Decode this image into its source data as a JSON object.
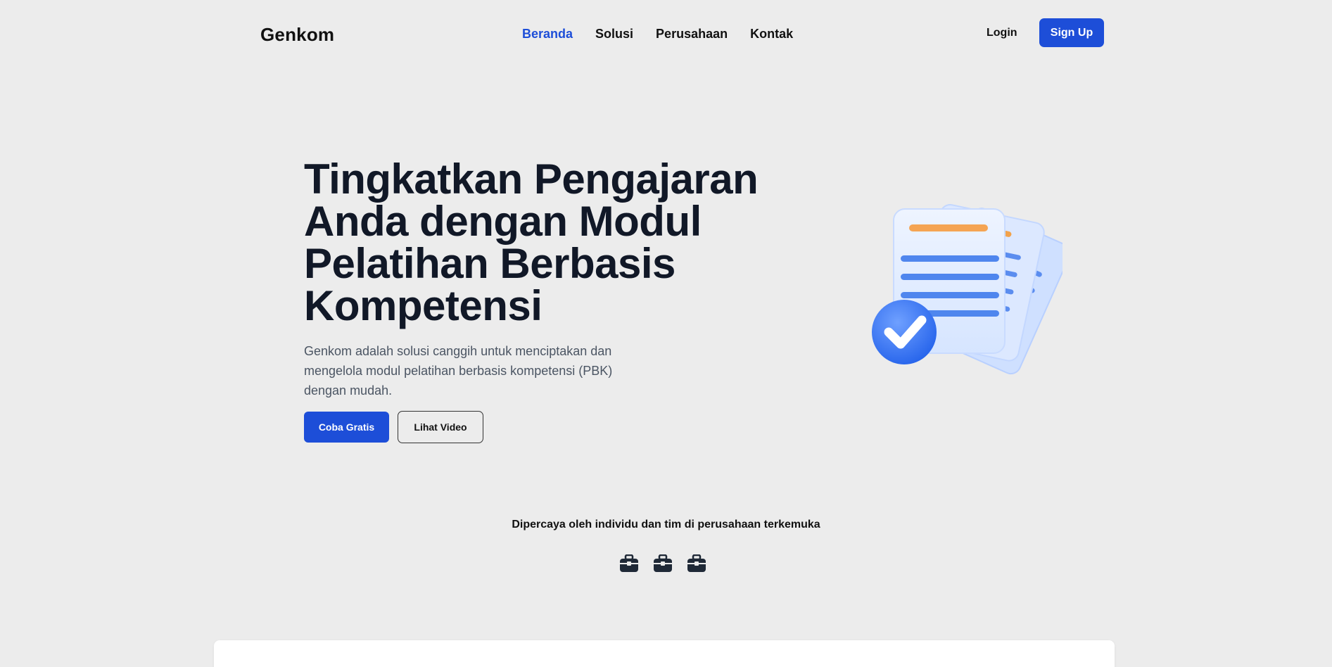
{
  "brand": "Genkom",
  "nav": {
    "items": [
      {
        "label": "Beranda",
        "active": true
      },
      {
        "label": "Solusi",
        "active": false
      },
      {
        "label": "Perusahaan",
        "active": false
      },
      {
        "label": "Kontak",
        "active": false
      }
    ],
    "login": "Login",
    "signup": "Sign Up"
  },
  "hero": {
    "title_lines": [
      "Tingkatkan Pengajaran",
      "Anda dengan Modul",
      "Pelatihan Berbasis",
      "Kompetensi"
    ],
    "description": "Genkom adalah solusi canggih untuk menciptakan dan mengelola modul pelatihan berbasis kompetensi (PBK) dengan mudah.",
    "primary_button": "Coba Gratis",
    "secondary_button": "Lihat Video",
    "illustration_icon": "documents-check-icon"
  },
  "trust": {
    "text": "Dipercaya oleh individu dan tim di perusahaan terkemuka",
    "logo_icons": [
      "briefcase-icon",
      "briefcase-icon",
      "briefcase-icon"
    ]
  },
  "colors": {
    "accent": "#1d4ed8",
    "background": "#ececec",
    "heading": "#111827",
    "body_text": "#4b5563"
  }
}
